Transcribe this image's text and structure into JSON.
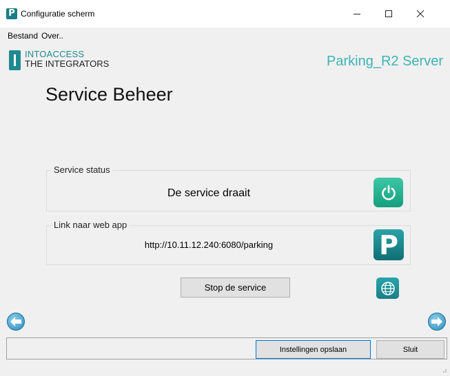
{
  "window": {
    "app_icon": "P",
    "title": "Configuratie scherm",
    "controls": {
      "minimize": "–",
      "maximize": "☐",
      "close": "✕"
    }
  },
  "menu": {
    "items": [
      {
        "label": "Bestand"
      },
      {
        "label": "Over.."
      }
    ]
  },
  "header": {
    "logo_line1": "INTOACCESS",
    "logo_line2": "THE INTEGRATORS",
    "server_name": "Parking_R2 Server"
  },
  "page": {
    "title": "Service Beheer",
    "service_status": {
      "legend": "Service status",
      "text": "De service draait",
      "icon": "power-icon",
      "accent": "#1ea985"
    },
    "web_link": {
      "legend": "Link naar web app",
      "url": "http://10.11.12.240:6080/parking",
      "icon_letter": "P",
      "accent": "#17858b"
    },
    "stop_button": "Stop de service",
    "globe_icon": "globe-icon"
  },
  "footer": {
    "save_button": "Instellingen opslaan",
    "close_button": "Sluit"
  }
}
